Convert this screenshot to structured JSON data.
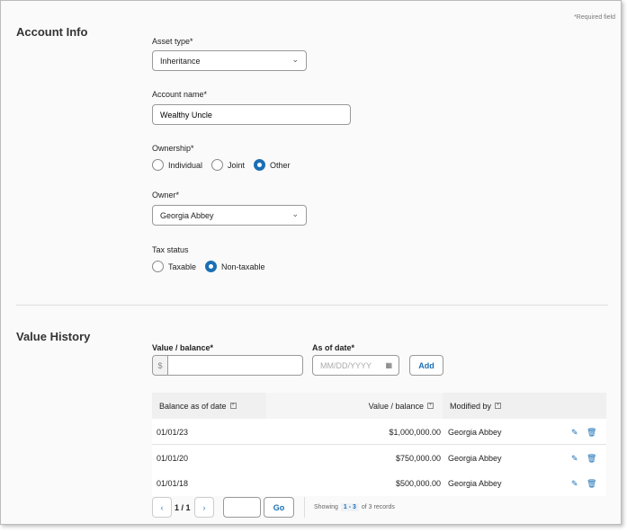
{
  "required_note": "*Required field",
  "account_info": {
    "title": "Account Info",
    "asset_type": {
      "label": "Asset type*",
      "value": "Inheritance"
    },
    "account_name": {
      "label": "Account name*",
      "value": "Wealthy Uncle"
    },
    "ownership": {
      "label": "Ownership*",
      "options": [
        "Individual",
        "Joint",
        "Other"
      ],
      "selected": "Other"
    },
    "owner": {
      "label": "Owner*",
      "value": "Georgia Abbey"
    },
    "tax_status": {
      "label": "Tax status",
      "options": [
        "Taxable",
        "Non-taxable"
      ],
      "selected": "Non-taxable"
    }
  },
  "value_history": {
    "title": "Value History",
    "value_label": "Value / balance*",
    "currency": "$",
    "value": "",
    "date_label": "As of date*",
    "date_placeholder": "MM/DD/YYYY",
    "add_label": "Add",
    "columns": [
      "Balance as of date",
      "Value / balance",
      "Modified by"
    ],
    "rows": [
      {
        "date": "01/01/23",
        "value": "$1,000,000.00",
        "by": "Georgia Abbey"
      },
      {
        "date": "01/01/20",
        "value": "$750,000.00",
        "by": "Georgia Abbey"
      },
      {
        "date": "01/01/18",
        "value": "$500,000.00",
        "by": "Georgia Abbey"
      }
    ],
    "pagination": {
      "page": "1 / 1",
      "go_label": "Go",
      "showing": "Showing",
      "range": "1 - 3",
      "of": "of 3 records"
    }
  }
}
